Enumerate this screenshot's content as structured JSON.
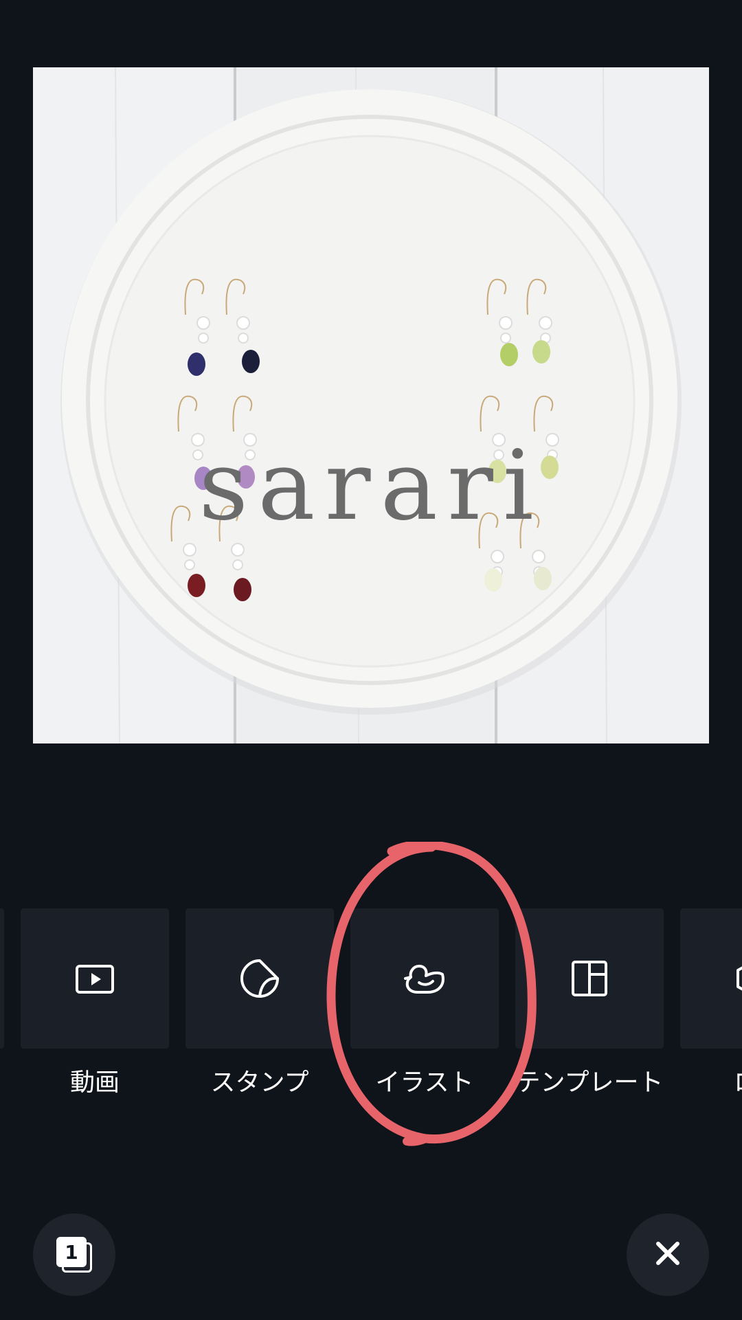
{
  "canvas": {
    "overlay_text": "sarari"
  },
  "tools": [
    {
      "label": "動画",
      "icon": "video-play-icon"
    },
    {
      "label": "スタンプ",
      "icon": "sticker-icon"
    },
    {
      "label": "イラスト",
      "icon": "duck-illustration-icon"
    },
    {
      "label": "テンプレート",
      "icon": "template-layout-icon"
    },
    {
      "label": "ロ",
      "icon": "partial-tool-icon"
    }
  ],
  "page_button": {
    "count": "1",
    "icon": "pages-icon"
  },
  "close_button": {
    "icon": "close-icon"
  },
  "colors": {
    "background": "#0f131a",
    "card": "#1b1f28",
    "annotation": "#e8646b"
  }
}
